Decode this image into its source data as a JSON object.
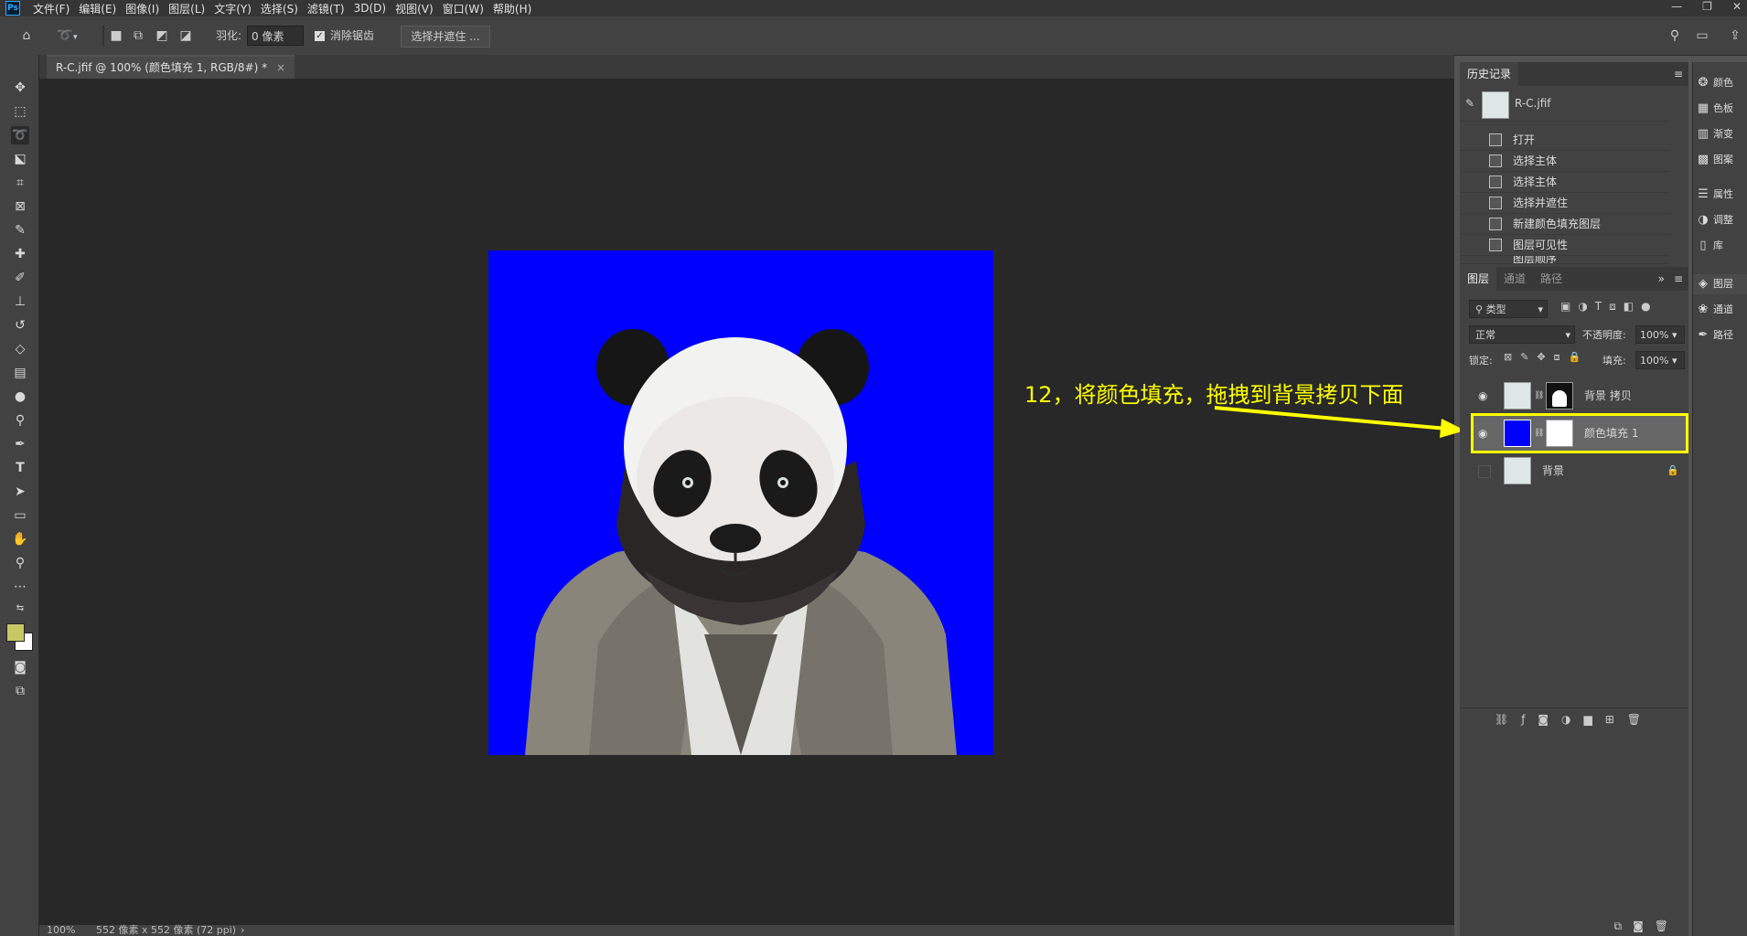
{
  "menubar": {
    "app_icon": "Ps",
    "items": [
      "文件(F)",
      "编辑(E)",
      "图像(I)",
      "图层(L)",
      "文字(Y)",
      "选择(S)",
      "滤镜(T)",
      "3D(D)",
      "视图(V)",
      "窗口(W)",
      "帮助(H)"
    ],
    "window_controls": [
      "—",
      "❐",
      "✕"
    ]
  },
  "options": {
    "feather_label": "羽化:",
    "feather_value": "0 像素",
    "antialias_label": "消除锯齿",
    "select_mask_button": "选择并遮住 ..."
  },
  "document": {
    "tab_title": "R-C.jfif @ 100% (颜色填充 1, RGB/8#) *",
    "tab_close": "×",
    "canvas_color": "#0000ff"
  },
  "status": {
    "zoom": "100%",
    "info": "552 像素 x 552 像素 (72 ppi)",
    "arrow": "›"
  },
  "annotation": {
    "text": "12，将颜色填充，拖拽到背景拷贝下面",
    "color": "#ffff00"
  },
  "history_panel": {
    "title": "历史记录",
    "snapshot_name": "R-C.jfif",
    "steps": [
      "打开",
      "选择主体",
      "选择主体",
      "选择并遮住",
      "新建颜色填充图层",
      "图层可见性",
      "图层顺序"
    ]
  },
  "layers_panel": {
    "tabs": [
      "图层",
      "通道",
      "路径"
    ],
    "filter_kind": "类型",
    "blend_mode": "正常",
    "opacity_label": "不透明度:",
    "opacity_value": "100%",
    "lock_label": "锁定:",
    "fill_label": "填充:",
    "fill_value": "100%",
    "layers": [
      {
        "name": "背景 拷贝",
        "visible": true
      },
      {
        "name": "颜色填充 1",
        "visible": true,
        "selected": true
      },
      {
        "name": "背景",
        "visible": false,
        "locked": true
      }
    ]
  },
  "far_panel": {
    "items": [
      "颜色",
      "色板",
      "渐变",
      "图案",
      "属性",
      "调整",
      "库",
      "图层",
      "通道",
      "路径"
    ]
  },
  "colors": {
    "foreground": "#c8c864",
    "background": "#ffffff",
    "highlight": "#ffff00"
  }
}
